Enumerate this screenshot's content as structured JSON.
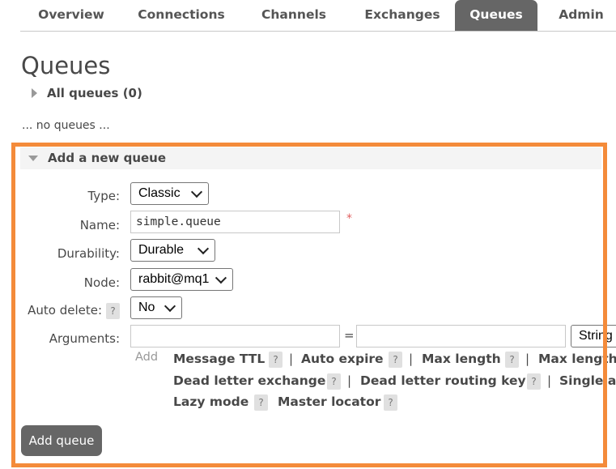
{
  "nav": {
    "tabs": [
      {
        "label": "Overview"
      },
      {
        "label": "Connections"
      },
      {
        "label": "Channels"
      },
      {
        "label": "Exchanges"
      },
      {
        "label": "Queues",
        "active": true
      },
      {
        "label": "Admin"
      }
    ]
  },
  "page_title": "Queues",
  "all_queues": {
    "label": "All queues (0)"
  },
  "no_queues_text": "... no queues ...",
  "add_queue": {
    "header": "Add a new queue",
    "fields": {
      "type": {
        "label": "Type:",
        "value": "Classic"
      },
      "name": {
        "label": "Name:",
        "value": "simple.queue",
        "required_marker": "*"
      },
      "durability": {
        "label": "Durability:",
        "value": "Durable"
      },
      "node": {
        "label": "Node:",
        "value": "rabbit@mq1"
      },
      "auto_delete": {
        "label": "Auto delete:",
        "help": "?",
        "value": "No"
      },
      "arguments": {
        "label": "Arguments:",
        "equals": "=",
        "type_value": "String"
      }
    },
    "add_label": "Add",
    "argument_links": [
      {
        "label": "Message TTL",
        "help": "?"
      },
      {
        "label": "Auto expire",
        "help": "?"
      },
      {
        "label": "Max length",
        "help": "?"
      },
      {
        "label": "Max length",
        "help": "?"
      },
      {
        "label": "Dead letter exchange",
        "help": "?"
      },
      {
        "label": "Dead letter routing key",
        "help": "?"
      },
      {
        "label": "Single ac",
        "help": "?"
      },
      {
        "label": "Lazy mode",
        "help": "?"
      },
      {
        "label": "Master locator",
        "help": "?"
      }
    ],
    "separator": "|",
    "submit_label": "Add queue"
  },
  "colors": {
    "highlight": "#f48b3a",
    "active_tab": "#666666",
    "button": "#666666"
  }
}
